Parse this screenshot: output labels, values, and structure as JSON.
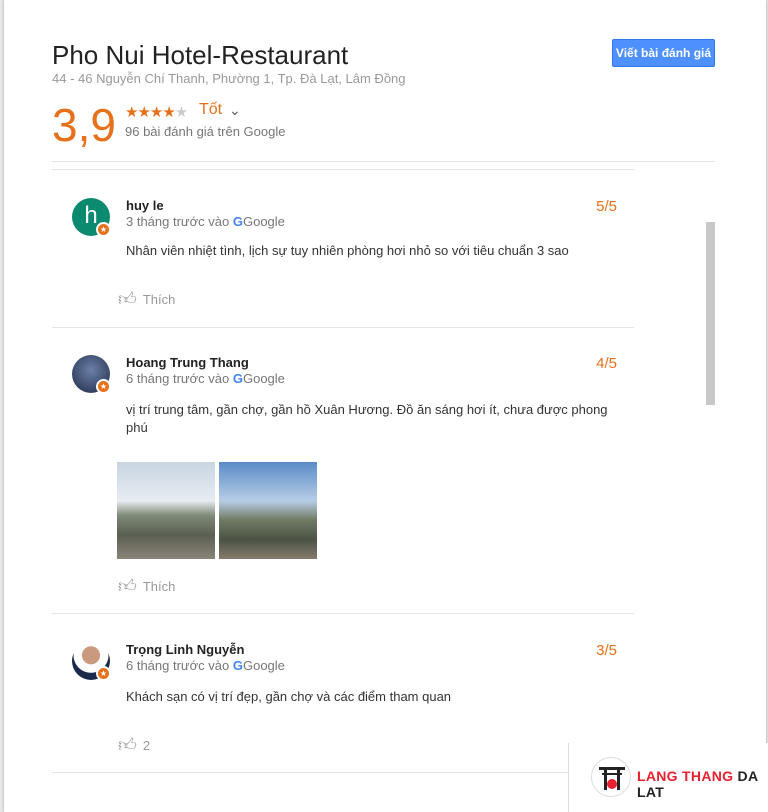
{
  "header": {
    "title": "Pho Nui Hotel-Restaurant",
    "address": "44 - 46 Nguyễn Chí Thanh, Phường 1, Tp. Đà Lạt, Lâm Đồng",
    "write_review": "Viết bài đánh giá",
    "score": "3,9",
    "stars": 4,
    "rating_label": "Tốt",
    "review_count": "96 bài đánh giá trên Google"
  },
  "colors": {
    "accent": "#e7711b",
    "button": "#4d90fe"
  },
  "reviews": [
    {
      "name": "huy le",
      "avatar_letter": "h",
      "avatar_color": "#0b8a6f",
      "when": "3 tháng trước vào",
      "source": "Google",
      "rating": "5/5",
      "text": "Nhân viên nhiệt tình, lịch sự tuy nhiên phòng hơi nhỏ so với tiêu chuẩn 3 sao",
      "like": "Thích"
    },
    {
      "name": "Hoang Trung Thang",
      "when": "6 tháng trước vào",
      "source": "Google",
      "rating": "4/5",
      "text": "vị trí trung tâm, gần chợ, gần hồ Xuân Hương. Đồ ăn sáng hơi ít, chưa được phong phú",
      "like": "Thích",
      "photos": 2
    },
    {
      "name": "Trọng Linh Nguyễn",
      "when": "6 tháng trước vào",
      "source": "Google",
      "rating": "3/5",
      "text": "Khách sạn có vị trí đẹp, gần chợ và các điểm tham quan",
      "like": "2"
    }
  ],
  "logo": {
    "part1": "LANG THANG",
    "part2": "DA LAT"
  }
}
